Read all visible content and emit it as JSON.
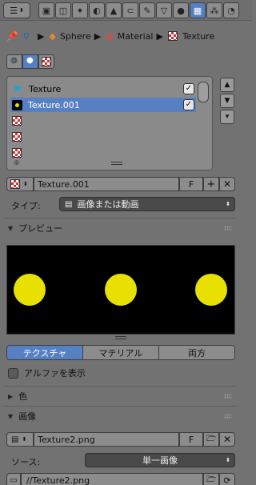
{
  "toolbar": {
    "editor_icon": "properties-editor-icon",
    "tabs": [
      {
        "icon": "render-icon",
        "glyph": "▣"
      },
      {
        "icon": "render-layers-icon",
        "glyph": "◫"
      },
      {
        "icon": "scene-icon",
        "glyph": "✦"
      },
      {
        "icon": "world-icon",
        "glyph": "◐"
      },
      {
        "icon": "object-icon",
        "glyph": "▲"
      },
      {
        "icon": "constraints-icon",
        "glyph": "⊂"
      },
      {
        "icon": "modifiers-icon",
        "glyph": "✎"
      },
      {
        "icon": "data-icon",
        "glyph": "▽"
      },
      {
        "icon": "material-icon",
        "glyph": "●"
      },
      {
        "icon": "texture-icon",
        "glyph": "▦",
        "active": true
      },
      {
        "icon": "particles-icon",
        "glyph": "⁂"
      },
      {
        "icon": "physics-icon",
        "glyph": "◔"
      }
    ]
  },
  "breadcrumb": {
    "items": [
      "Sphere",
      "Material",
      "Texture"
    ]
  },
  "slot_list": {
    "items": [
      {
        "label": "Texture",
        "icon": "blend-texture-icon",
        "checked": true,
        "selected": false
      },
      {
        "label": "Texture.001",
        "icon": "image-texture-icon",
        "checked": true,
        "selected": true
      },
      {
        "label": "",
        "icon": "empty-slot-icon"
      },
      {
        "label": "",
        "icon": "empty-slot-icon"
      },
      {
        "label": "",
        "icon": "empty-slot-icon"
      }
    ],
    "check_glyph": "✓"
  },
  "datablock": {
    "name": "Texture.001",
    "fake_user": "F"
  },
  "type_row": {
    "label": "タイプ:",
    "value": "画像または動画"
  },
  "preview_panel": {
    "title": "プレビュー"
  },
  "preview_tabs": [
    "テクスチャ",
    "マテリアル",
    "両方"
  ],
  "show_alpha": {
    "label": "アルファを表示",
    "checked": false
  },
  "color_panel": {
    "title": "色"
  },
  "image_panel": {
    "title": "画像",
    "image_name": "Texture2.png",
    "fake_user": "F",
    "source_label": "ソース:",
    "source_value": "単一画像",
    "filepath": "//Texture2.png"
  },
  "colors": {
    "accent": "#5680c2",
    "panel_bg": "#727272",
    "preview_dot": "#e8e000"
  }
}
